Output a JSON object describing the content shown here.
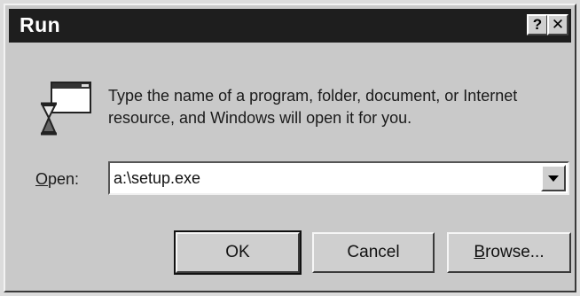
{
  "window": {
    "title": "Run",
    "help_glyph": "?",
    "close_glyph": "✕"
  },
  "description": "Type the name of a program, folder, document, or Internet resource, and Windows will open it for you.",
  "open_field": {
    "label_mnemonic": "O",
    "label_rest": "pen:",
    "value": "a:\\setup.exe"
  },
  "buttons": {
    "ok_label": "OK",
    "cancel_label": "Cancel",
    "browse_mnemonic": "B",
    "browse_rest": "rowse..."
  },
  "icons": {
    "run": "run-program-icon",
    "dropdown": "chevron-down-icon",
    "help": "help-icon",
    "close": "close-icon"
  },
  "colors": {
    "titlebar": "#1e1e1e",
    "dialog_face": "#c9c9c9"
  }
}
